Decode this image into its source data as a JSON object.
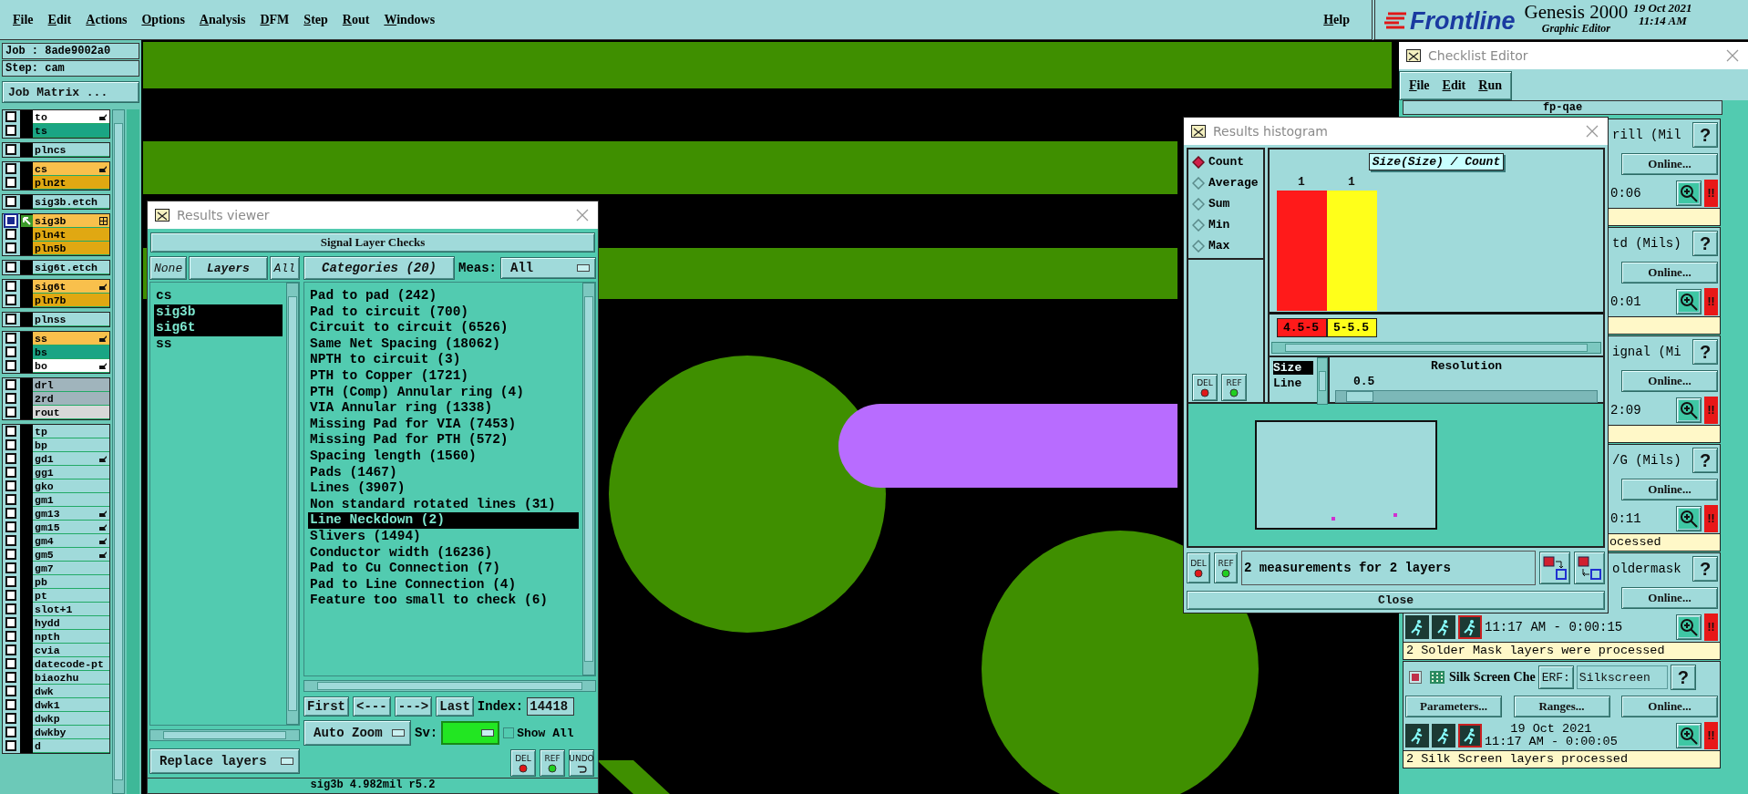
{
  "menu_bar": {
    "items": [
      "File",
      "Edit",
      "Actions",
      "Options",
      "Analysis",
      "DFM",
      "Step",
      "Rout",
      "Windows"
    ],
    "help": "Help"
  },
  "brand": {
    "logo": "Frontline",
    "product": "Genesis 2000",
    "subtitle": "Graphic Editor",
    "date": "19 Oct 2021",
    "time": "11:14 AM"
  },
  "job_panel": {
    "job": "Job : 8ade9002a0",
    "step": "Step: cam",
    "matrix_button": "Job Matrix ...",
    "layer_groups": [
      {
        "layers": [
          {
            "name": "to",
            "color": "#ffffff",
            "kind": "hand",
            "work": false
          },
          {
            "name": "ts",
            "color": "#1aa584",
            "kind": "plain",
            "work": false
          }
        ]
      },
      {
        "layers": [
          {
            "name": "plncs",
            "color": "#a0dada",
            "kind": "plain",
            "work": false
          }
        ]
      },
      {
        "layers": [
          {
            "name": "cs",
            "color": "#f9c04c",
            "kind": "hand",
            "work": false
          },
          {
            "name": "pln2t",
            "color": "#e0a812",
            "kind": "plain",
            "work": false
          }
        ]
      },
      {
        "layers": [
          {
            "name": "sig3b.etch",
            "color": "#a0dada",
            "kind": "plain",
            "work": false
          }
        ]
      },
      {
        "layers": [
          {
            "name": "sig3b",
            "color": "#f9c04c",
            "kind": "grid",
            "work": true
          },
          {
            "name": "pln4t",
            "color": "#e0a812",
            "kind": "plain",
            "work": false
          },
          {
            "name": "pln5b",
            "color": "#e0a812",
            "kind": "plain",
            "work": false
          }
        ]
      },
      {
        "layers": [
          {
            "name": "sig6t.etch",
            "color": "#a0dada",
            "kind": "plain",
            "work": false
          }
        ]
      },
      {
        "layers": [
          {
            "name": "sig6t",
            "color": "#f9c04c",
            "kind": "hand",
            "work": false
          },
          {
            "name": "pln7b",
            "color": "#e0a812",
            "kind": "plain",
            "work": false
          }
        ]
      },
      {
        "layers": [
          {
            "name": "plnss",
            "color": "#a0dada",
            "kind": "plain",
            "work": false
          }
        ]
      },
      {
        "layers": [
          {
            "name": "ss",
            "color": "#f9c04c",
            "kind": "hand",
            "work": false
          },
          {
            "name": "bs",
            "color": "#1aa584",
            "kind": "plain",
            "work": false
          },
          {
            "name": "bo",
            "color": "#ffffff",
            "kind": "hand",
            "work": false
          }
        ]
      },
      {
        "layers": [
          {
            "name": "drl",
            "color": "#a0b4bc",
            "kind": "plain",
            "work": false
          },
          {
            "name": "2rd",
            "color": "#a0b4bc",
            "kind": "plain",
            "work": false
          },
          {
            "name": "rout",
            "color": "#d8d8d8",
            "kind": "plain",
            "work": false
          }
        ]
      },
      {
        "layers": [
          {
            "name": "tp",
            "color": "#a0dada",
            "kind": "plain",
            "work": false
          },
          {
            "name": "bp",
            "color": "#a0dada",
            "kind": "plain",
            "work": false
          },
          {
            "name": "gd1",
            "color": "#a0dada",
            "kind": "hand",
            "work": false
          },
          {
            "name": "gg1",
            "color": "#a0dada",
            "kind": "plain",
            "work": false
          },
          {
            "name": "gko",
            "color": "#a0dada",
            "kind": "plain",
            "work": false
          },
          {
            "name": "gm1",
            "color": "#a0dada",
            "kind": "plain",
            "work": false
          },
          {
            "name": "gm13",
            "color": "#a0dada",
            "kind": "hand",
            "work": false
          },
          {
            "name": "gm15",
            "color": "#a0dada",
            "kind": "hand",
            "work": false
          },
          {
            "name": "gm4",
            "color": "#a0dada",
            "kind": "hand",
            "work": false
          },
          {
            "name": "gm5",
            "color": "#a0dada",
            "kind": "hand",
            "work": false
          },
          {
            "name": "gm7",
            "color": "#a0dada",
            "kind": "plain",
            "work": false
          },
          {
            "name": "pb",
            "color": "#a0dada",
            "kind": "plain",
            "work": false
          },
          {
            "name": "pt",
            "color": "#a0dada",
            "kind": "plain",
            "work": false
          },
          {
            "name": "slot+1",
            "color": "#a0dada",
            "kind": "plain",
            "work": false
          },
          {
            "name": "hydd",
            "color": "#a0dada",
            "kind": "plain",
            "work": false
          },
          {
            "name": "npth",
            "color": "#a0dada",
            "kind": "plain",
            "work": false
          },
          {
            "name": "cvia",
            "color": "#a0dada",
            "kind": "plain",
            "work": false
          },
          {
            "name": "datecode-pt",
            "color": "#a0dada",
            "kind": "plain",
            "work": false
          },
          {
            "name": "biaozhu",
            "color": "#a0dada",
            "kind": "plain",
            "work": false
          },
          {
            "name": "dwk",
            "color": "#a0dada",
            "kind": "plain",
            "work": false
          },
          {
            "name": "dwk1",
            "color": "#a0dada",
            "kind": "plain",
            "work": false
          },
          {
            "name": "dwkp",
            "color": "#a0dada",
            "kind": "plain",
            "work": false
          },
          {
            "name": "dwkby",
            "color": "#a0dada",
            "kind": "plain",
            "work": false
          },
          {
            "name": "d",
            "color": "#a0dada",
            "kind": "plain",
            "work": false
          }
        ]
      }
    ]
  },
  "results_viewer": {
    "title": "Results viewer",
    "header": "Signal Layer Checks",
    "none_button": "None",
    "layers_label": "Layers",
    "all_button": "All",
    "layers": [
      {
        "name": "cs",
        "selected": false
      },
      {
        "name": "sig3b",
        "selected": true
      },
      {
        "name": "sig6t",
        "selected": true
      },
      {
        "name": "ss",
        "selected": false
      }
    ],
    "categories_button": "Categories (20)",
    "meas_label": "Meas:",
    "meas_value": "All",
    "categories": [
      {
        "name": "Pad to pad (242)",
        "selected": false
      },
      {
        "name": "Pad to circuit (700)",
        "selected": false
      },
      {
        "name": "Circuit to circuit (6526)",
        "selected": false
      },
      {
        "name": "Same Net Spacing (18062)",
        "selected": false
      },
      {
        "name": "NPTH to circuit (3)",
        "selected": false
      },
      {
        "name": "PTH to Copper (1721)",
        "selected": false
      },
      {
        "name": "PTH (Comp) Annular ring (4)",
        "selected": false
      },
      {
        "name": "VIA Annular ring (1338)",
        "selected": false
      },
      {
        "name": "Missing Pad for VIA (7453)",
        "selected": false
      },
      {
        "name": "Missing Pad for PTH (572)",
        "selected": false
      },
      {
        "name": "Spacing length (1560)",
        "selected": false
      },
      {
        "name": "Pads (1467)",
        "selected": false
      },
      {
        "name": "Lines (3907)",
        "selected": false
      },
      {
        "name": "Non standard rotated lines (31)",
        "selected": false
      },
      {
        "name": "Line Neckdown (2)",
        "selected": true
      },
      {
        "name": "Slivers (1494)",
        "selected": false
      },
      {
        "name": "Conductor width (16236)",
        "selected": false
      },
      {
        "name": "Pad to Cu Connection (7)",
        "selected": false
      },
      {
        "name": "Pad to Line Connection (4)",
        "selected": false
      },
      {
        "name": "Feature too small to check (6)",
        "selected": false
      }
    ],
    "nav_buttons": [
      "First",
      "<---",
      "--->",
      "Last"
    ],
    "index_label": "Index:",
    "index_value": "14418",
    "zoom_mode": "Auto Zoom",
    "sv_label": "Sv:",
    "show_all": {
      "label": "Show All",
      "checked": false
    },
    "replace_mode": "Replace layers",
    "tool_buttons": [
      {
        "label": "DEL",
        "kind": "del"
      },
      {
        "label": "REF",
        "kind": "ref"
      },
      {
        "label": "UNDO",
        "kind": "undo"
      }
    ],
    "status": "sig3b 4.982mil r5.2"
  },
  "histogram": {
    "title": "Results histogram",
    "modes": [
      {
        "label": "Count",
        "selected": true
      },
      {
        "label": "Average",
        "selected": false
      },
      {
        "label": "Sum",
        "selected": false
      },
      {
        "label": "Min",
        "selected": false
      },
      {
        "label": "Max",
        "selected": false
      }
    ],
    "side_buttons": [
      {
        "label": "DEL",
        "kind": "del"
      },
      {
        "label": "REF",
        "kind": "ref"
      }
    ],
    "chart_data": {
      "type": "bar",
      "title": "Size(Size) / Count",
      "categories": [
        "4.5-5",
        "5-5.5"
      ],
      "values": [
        1,
        1
      ],
      "value_labels": [
        "1",
        "1"
      ]
    },
    "bins": [
      {
        "color": "#ff1a1a"
      },
      {
        "color": "#ffff1a"
      }
    ],
    "fields": [
      {
        "label": "Size",
        "selected": true
      },
      {
        "label": "Line",
        "selected": false
      }
    ],
    "resolution": {
      "label": "Resolution",
      "value": "0.5",
      "level": 0.04
    },
    "bottom_buttons": [
      {
        "label": "DEL",
        "kind": "del"
      },
      {
        "label": "REF",
        "kind": "ref"
      }
    ],
    "message": "2 measurements for 2 layers",
    "close": "Close"
  },
  "checklist": {
    "title": "Checklist Editor",
    "menu": [
      "File",
      "Edit",
      "Run"
    ],
    "name": "fp-qae",
    "checks": [
      {
        "kind": "clipped",
        "name": "rill (Mil",
        "help": "?",
        "online": "Online...",
        "time": "0:06",
        "alert": "!!"
      },
      {
        "kind": "clipped",
        "name": "td (Mils)",
        "help": "?",
        "online": "Online...",
        "time": "0:01",
        "alert": "!!"
      },
      {
        "kind": "clipped",
        "name": "ignal (Mi",
        "help": "?",
        "online": "Online...",
        "time": "2:09",
        "alert": "!!"
      },
      {
        "kind": "clipped",
        "name": "/G (Mils)",
        "help": "?",
        "online": "Online...",
        "time": "0:11",
        "alert": "!!",
        "message": "ocessed"
      },
      {
        "kind": "clipped_low",
        "name": "oldermask",
        "help": "?",
        "online": "Online...",
        "time": "11:17 AM - 0:00:15",
        "alert": "!!",
        "message": "2 Solder Mask layers were processed"
      },
      {
        "kind": "full",
        "checked": true,
        "name": "Silk Screen Che",
        "erf_label": "ERF:",
        "erf_value": "Silkscreen",
        "help": "?",
        "buttons": [
          "Parameters...",
          "Ranges...",
          "Online..."
        ],
        "date": "19 Oct 2021",
        "time": "11:17 AM - 0:00:05",
        "alert": "!!",
        "message": "2 Silk Screen layers processed"
      }
    ]
  }
}
